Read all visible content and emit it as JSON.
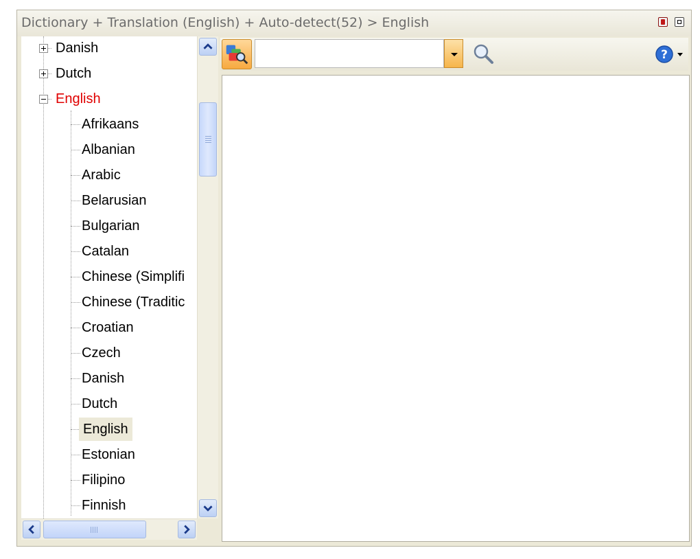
{
  "window": {
    "title": "Dictionary + Translation (English) + Auto-detect(52) > English"
  },
  "tree": {
    "top_nodes": [
      {
        "label": "Danish",
        "expanded": false
      },
      {
        "label": "Dutch",
        "expanded": false
      },
      {
        "label": "English",
        "expanded": true,
        "highlight_color": "#e00000"
      }
    ],
    "children": [
      "Afrikaans",
      "Albanian",
      "Arabic",
      "Belarusian",
      "Bulgarian",
      "Catalan",
      "Chinese (Simplifi",
      "Chinese (Traditic",
      "Croatian",
      "Czech",
      "Danish",
      "Dutch",
      "English",
      "Estonian",
      "Filipino",
      "Finnish"
    ],
    "selected_child": "English"
  },
  "search": {
    "value": "",
    "placeholder": ""
  },
  "icons": {
    "source": "translate-source-icon",
    "dropdown": "chevron-down-icon",
    "search": "magnifier-icon",
    "help": "help-icon",
    "pin": "pin-icon",
    "maximize": "maximize-icon"
  },
  "colors": {
    "accent": "#f7a940",
    "selected_text": "#e00000",
    "scrollbar": "#c2d4f9"
  }
}
